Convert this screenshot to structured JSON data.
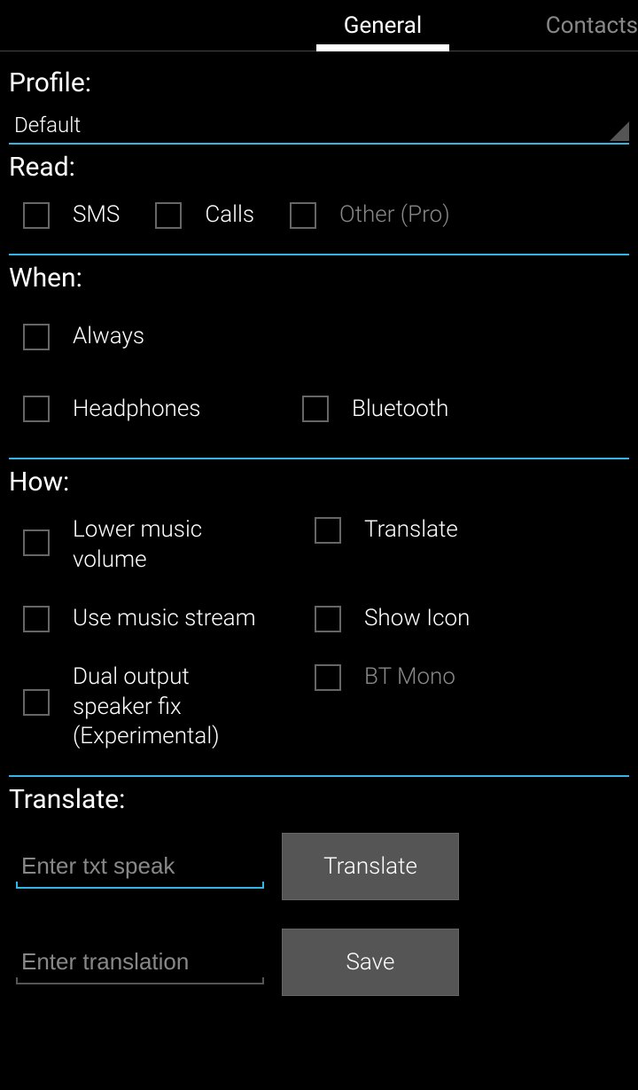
{
  "tabs": {
    "left_spacer": "",
    "general": "General",
    "contacts": "Contacts"
  },
  "profile": {
    "label": "Profile:",
    "value": "Default"
  },
  "read": {
    "label": "Read:",
    "options": {
      "sms": "SMS",
      "calls": "Calls",
      "other_pro": "Other (Pro)"
    }
  },
  "when": {
    "label": "When:",
    "options": {
      "always": "Always",
      "headphones": "Headphones",
      "bluetooth": "Bluetooth"
    }
  },
  "how": {
    "label": "How:",
    "options": {
      "lower_music": "Lower music volume",
      "translate": "Translate",
      "use_music_stream": "Use music stream",
      "show_icon": "Show Icon",
      "dual_output": "Dual output speaker fix (Experimental)",
      "bt_mono": "BT Mono"
    }
  },
  "translate": {
    "label": "Translate:",
    "txt_speak_placeholder": "Enter txt speak",
    "translation_placeholder": "Enter translation",
    "translate_button": "Translate",
    "save_button": "Save"
  }
}
